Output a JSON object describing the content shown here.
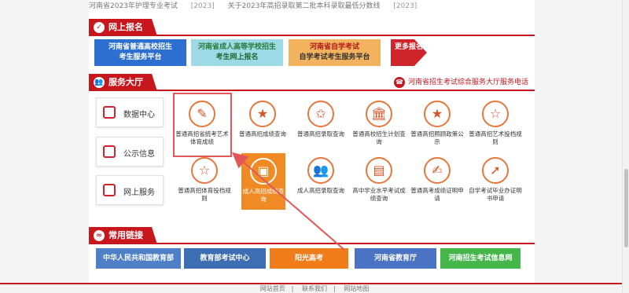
{
  "top_notice": {
    "title": "河南省2023年护理专业考试",
    "date": "[2023]",
    "title2": "关于2023年高招录取第二批本科录取最低分数线",
    "date2": "[2023]"
  },
  "reg": {
    "title": "网上报名",
    "b1_title": "河南省普通高校招生",
    "b1_sub": "考生服务平台",
    "b2_title": "河南省成人高等学校招生",
    "b2_sub": "考生网上报名",
    "b3_title": "河南省自学考试",
    "b3_sub": "自学考试考生服务平台",
    "more": "更多报名"
  },
  "hall": {
    "title": "服务大厅",
    "hotline": "河南省招生考试综合服务大厅服务电话",
    "side": [
      "数据中心",
      "公示信息",
      "网上服务"
    ],
    "items": [
      {
        "label": "普通高招省统考艺术体育成绩",
        "icon": "edit-icon",
        "glyph": "✎"
      },
      {
        "label": "普通高招成绩查询",
        "icon": "star-icon",
        "glyph": "★"
      },
      {
        "label": "普通高招录取查询",
        "icon": "star-outline-icon",
        "glyph": "✩"
      },
      {
        "label": "普通高校招生计划查询",
        "icon": "building-icon",
        "glyph": "🏛"
      },
      {
        "label": "普通高招照顾政策公示",
        "icon": "star-icon",
        "glyph": "★"
      },
      {
        "label": "普通高招艺术投档规则",
        "icon": "star-outline-icon",
        "glyph": "☆"
      },
      {
        "label": "普通高招体育投档规则",
        "icon": "star-outline-icon",
        "glyph": "☆"
      },
      {
        "label": "成人高招成绩查询",
        "icon": "image-icon",
        "glyph": "▣"
      },
      {
        "label": "成人高招录取查询",
        "icon": "people-icon",
        "glyph": "👥"
      },
      {
        "label": "高中学业水平考试成绩查询",
        "icon": "document-icon",
        "glyph": "▤"
      },
      {
        "label": "普通高考成绩证明申请",
        "icon": "certificate-icon",
        "glyph": "✍"
      },
      {
        "label": "自学考试毕业办证明书申请",
        "icon": "export-icon",
        "glyph": "➚"
      }
    ]
  },
  "links": {
    "title": "常用链接",
    "items": [
      "中华人民共和国教育部",
      "教育部考试中心",
      "阳光高考",
      "河南省教育厅",
      "河南招生考试信息网"
    ]
  },
  "footer": {
    "a": "网站首页",
    "b": "联系我们",
    "c": "网站地图"
  }
}
